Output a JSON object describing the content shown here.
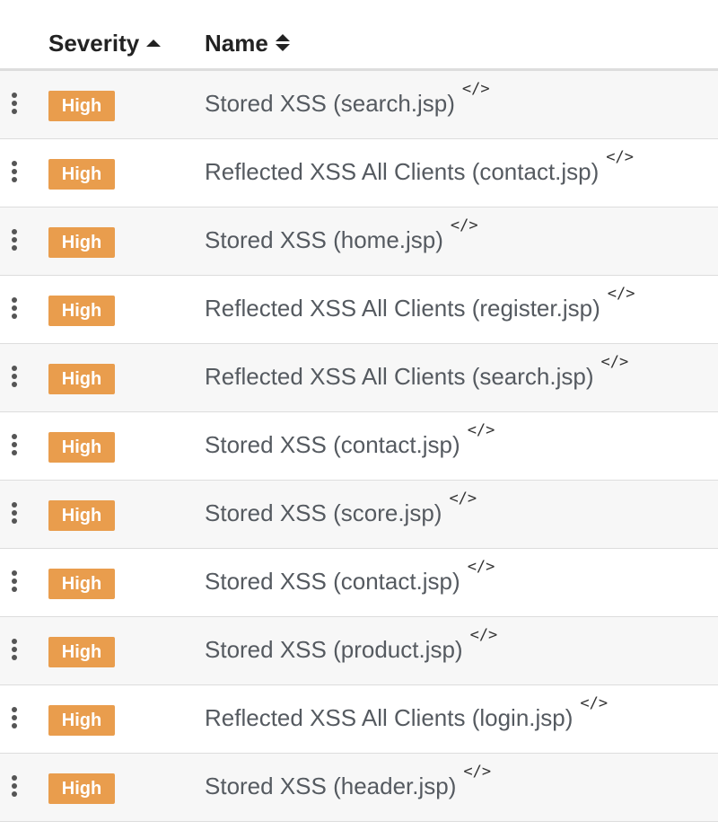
{
  "header": {
    "severity_label": "Severity",
    "name_label": "Name"
  },
  "icons": {
    "row_menu": "kebab-icon",
    "code_link": "code-icon",
    "sort_ascending": "sort-up-icon",
    "sort_both": "sort-both-icon"
  },
  "colors": {
    "high_badge": "#e99d4d",
    "row_stripe": "#f7f7f7"
  },
  "code_glyph": "</>",
  "rows": [
    {
      "severity": "High",
      "name": "Stored XSS (search.jsp)"
    },
    {
      "severity": "High",
      "name": "Reflected XSS All Clients (contact.jsp)"
    },
    {
      "severity": "High",
      "name": "Stored XSS (home.jsp)"
    },
    {
      "severity": "High",
      "name": "Reflected XSS All Clients (register.jsp)"
    },
    {
      "severity": "High",
      "name": "Reflected XSS All Clients (search.jsp)"
    },
    {
      "severity": "High",
      "name": "Stored XSS (contact.jsp)"
    },
    {
      "severity": "High",
      "name": "Stored XSS (score.jsp)"
    },
    {
      "severity": "High",
      "name": "Stored XSS (contact.jsp)"
    },
    {
      "severity": "High",
      "name": "Stored XSS (product.jsp)"
    },
    {
      "severity": "High",
      "name": "Reflected XSS All Clients (login.jsp)"
    },
    {
      "severity": "High",
      "name": "Stored XSS (header.jsp)"
    }
  ]
}
